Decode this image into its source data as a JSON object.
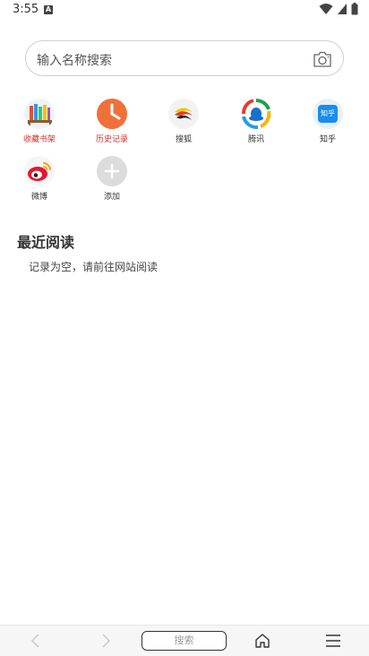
{
  "status_bar": {
    "time": "3:55",
    "a_badge": "A"
  },
  "search": {
    "placeholder": "输入名称搜索"
  },
  "shortcuts": [
    {
      "label": "收藏书架",
      "icon": "bookshelf-icon"
    },
    {
      "label": "历史记录",
      "icon": "clock-icon"
    },
    {
      "label": "搜狐",
      "icon": "sohu-icon"
    },
    {
      "label": "腾讯",
      "icon": "tencent-icon"
    },
    {
      "label": "知乎",
      "icon": "zhihu-icon",
      "icon_text": "知乎"
    },
    {
      "label": "微博",
      "icon": "weibo-icon"
    },
    {
      "label": "添加",
      "icon": "add-icon"
    }
  ],
  "recent": {
    "title": "最近阅读",
    "empty_message": "记录为空，请前往网站阅读"
  },
  "bottom_bar": {
    "search_label": "搜索"
  },
  "colors": {
    "accent_red": "#d0342c",
    "clock_orange": "#f0703a",
    "zhihu_blue": "#1a8cf0"
  }
}
